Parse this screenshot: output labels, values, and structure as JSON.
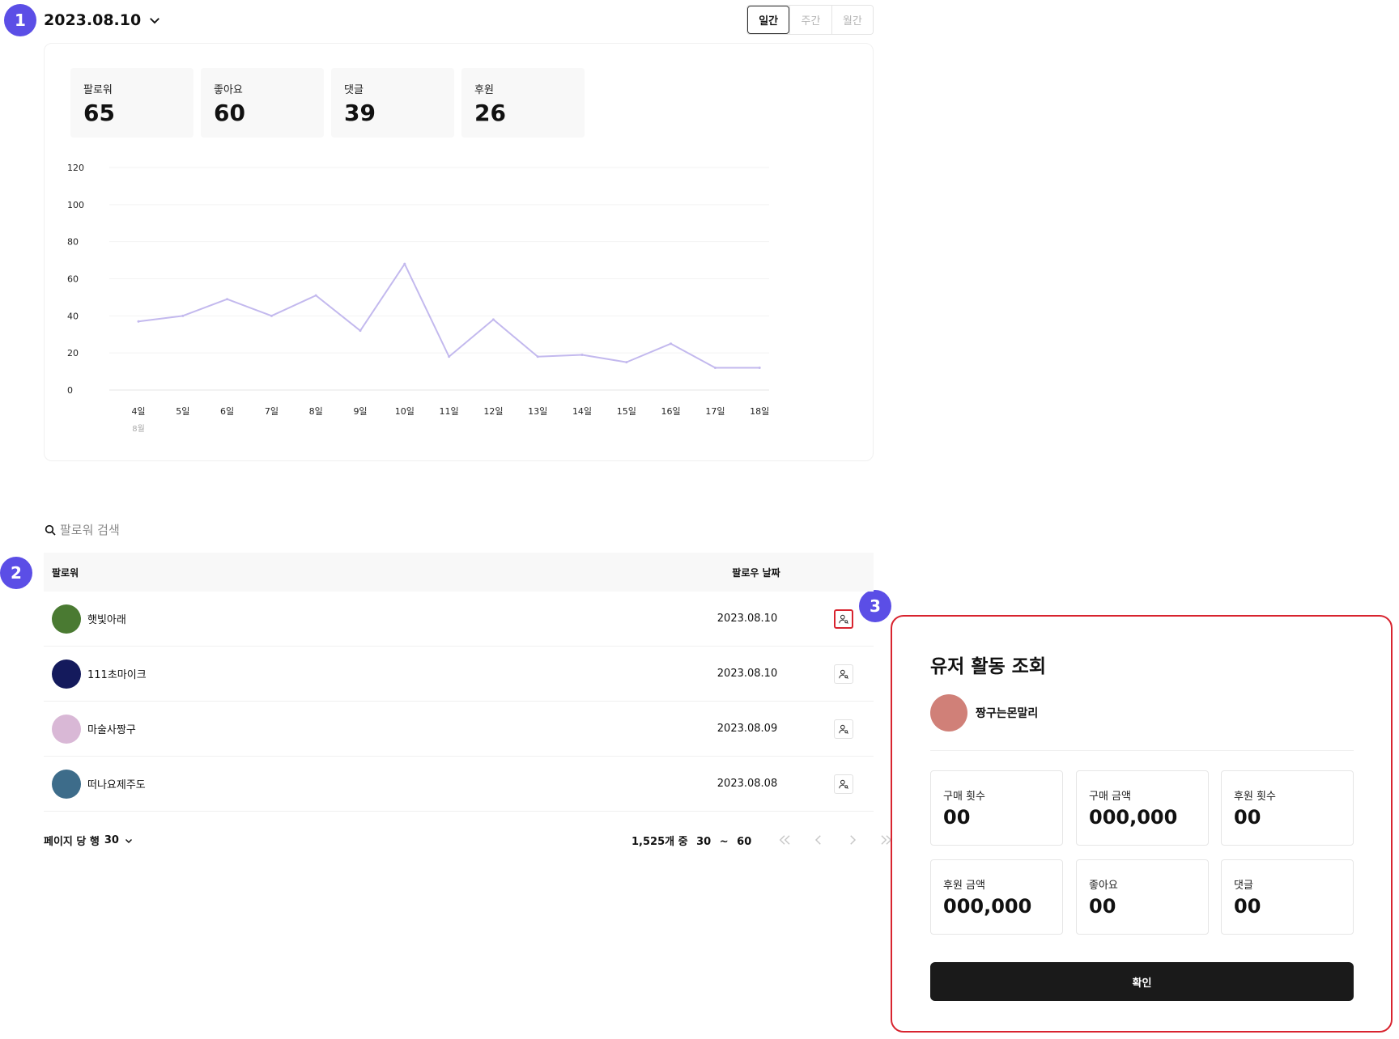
{
  "markers": [
    "1",
    "2",
    "3"
  ],
  "header": {
    "date": "2023.08.10",
    "period_tabs": [
      {
        "label": "일간",
        "active": true
      },
      {
        "label": "주간",
        "active": false
      },
      {
        "label": "월간",
        "active": false
      }
    ]
  },
  "stats": [
    {
      "label": "팔로워",
      "value": "65"
    },
    {
      "label": "좋아요",
      "value": "60"
    },
    {
      "label": "댓글",
      "value": "39"
    },
    {
      "label": "후원",
      "value": "26"
    }
  ],
  "chart_data": {
    "type": "line",
    "categories": [
      "4일",
      "5일",
      "6일",
      "7일",
      "8일",
      "9일",
      "10일",
      "11일",
      "12일",
      "13일",
      "14일",
      "15일",
      "16일",
      "17일",
      "18일"
    ],
    "x_sublabel": "8월",
    "series": [
      {
        "values": [
          37,
          40,
          49,
          40,
          51,
          32,
          68,
          18,
          38,
          18,
          19,
          15,
          25,
          12,
          12
        ]
      }
    ],
    "yticks": [
      0,
      20,
      40,
      60,
      80,
      100,
      120
    ],
    "ylim": [
      0,
      120
    ],
    "grid": true,
    "line_color": "#c3b9ee"
  },
  "search": {
    "placeholder": "팔로워 검색"
  },
  "table": {
    "headers": {
      "name": "팔로워",
      "date": "팔로우 날짜"
    },
    "rows": [
      {
        "name": "햇빛아래",
        "date": "2023.08.10",
        "avatar_color": "#4a7a32"
      },
      {
        "name": "111초마이크",
        "date": "2023.08.10",
        "avatar_color": "#141a5c"
      },
      {
        "name": "마술사짱구",
        "date": "2023.08.09",
        "avatar_color": "#d9b8d6"
      },
      {
        "name": "떠나요제주도",
        "date": "2023.08.08",
        "avatar_color": "#3d6c8a"
      }
    ]
  },
  "pagination": {
    "rows_per_page_label": "페이지 당 행",
    "rows_per_page": "30",
    "total_label": "1,525개 중",
    "range_start": "30",
    "range_sep": "~",
    "range_end": "60"
  },
  "modal": {
    "title": "유저 활동 조회",
    "user_name": "짱구는몬말리",
    "avatar_color": "#d08078",
    "stats": [
      {
        "label": "구매 횟수",
        "value": "00"
      },
      {
        "label": "구매 금액",
        "value": "000,000"
      },
      {
        "label": "후원 횟수",
        "value": "00"
      },
      {
        "label": "후원 금액",
        "value": "000,000"
      },
      {
        "label": "좋아요",
        "value": "00"
      },
      {
        "label": "댓글",
        "value": "00"
      }
    ],
    "confirm_label": "확인"
  },
  "colors": {
    "accent": "#5b4ee6",
    "highlight": "#d8242f"
  }
}
